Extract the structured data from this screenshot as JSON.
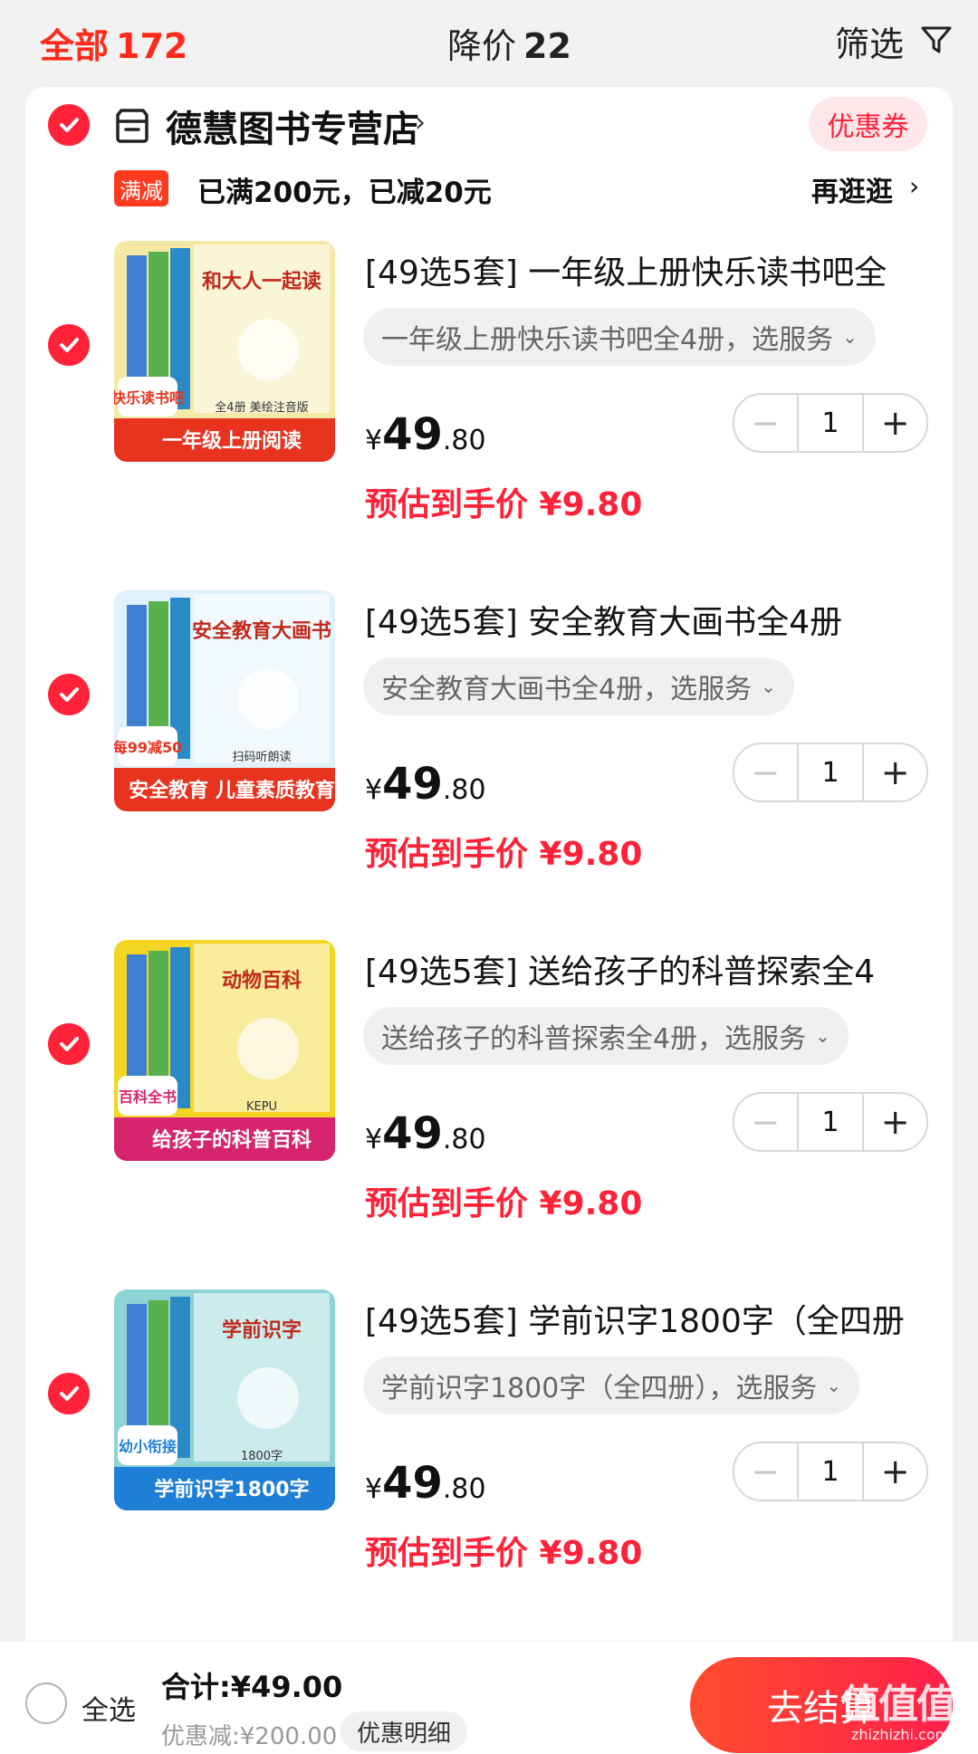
{
  "tabs": {
    "all_label": "全部",
    "all_count": "172",
    "drop_label": "降价",
    "drop_count": "22",
    "filter_label": "筛选"
  },
  "store": {
    "name": "德慧图书专营店",
    "arrow": "›",
    "coupon": "优惠券",
    "promo_tag": "满减",
    "promo_text": "已满200元，已减20元",
    "browse": "再逛逛",
    "browse_arrow": "›"
  },
  "items": [
    {
      "title": "[49选5套] 一年级上册快乐读书吧全",
      "sku": "一年级上册快乐读书吧全4册，选服务",
      "price_yen": "¥",
      "price_int": "49",
      "price_dec": ".80",
      "estimate": "预估到手价 ¥9.80",
      "qty": "1",
      "cover": {
        "banner": "一年级上册阅读",
        "badge": "快乐读书吧",
        "small": "全4册 美绘注音版",
        "headline": "和大人一起读",
        "bg": "#f4e9a6",
        "accent": "#e8331f"
      }
    },
    {
      "title": "[49选5套] 安全教育大画书全4册",
      "sku": "安全教育大画书全4册，选服务",
      "price_yen": "¥",
      "price_int": "49",
      "price_dec": ".80",
      "estimate": "预估到手价 ¥9.80",
      "qty": "1",
      "cover": {
        "banner": "安全教育 儿童素质教育",
        "badge": "每99减50",
        "small": "扫码听朗读",
        "headline": "安全教育大画书",
        "bg": "#dff1fb",
        "accent": "#e8331f"
      }
    },
    {
      "title": "[49选5套] 送给孩子的科普探索全4",
      "sku": "送给孩子的科普探索全4册，选服务",
      "price_yen": "¥",
      "price_int": "49",
      "price_dec": ".80",
      "estimate": "预估到手价 ¥9.80",
      "qty": "1",
      "cover": {
        "banner": "给孩子的科普百科",
        "badge": "百科全书",
        "small": "KEPU",
        "headline": "动物百科",
        "bg": "#f2d623",
        "accent": "#d6246e"
      }
    },
    {
      "title": "[49选5套] 学前识字1800字（全四册",
      "sku": "学前识字1800字（全四册），选服务",
      "price_yen": "¥",
      "price_int": "49",
      "price_dec": ".80",
      "estimate": "预估到手价 ¥9.80",
      "qty": "1",
      "cover": {
        "banner": "学前识字1800字",
        "badge": "幼小衔接",
        "small": "1800字",
        "headline": "学前识字",
        "bg": "#8fd3d8",
        "accent": "#1f7fd6"
      }
    }
  ],
  "bottom": {
    "select_all": "全选",
    "total": "合计:¥49.00",
    "discount": "优惠减:¥200.00",
    "detail": "优惠明细",
    "checkout": "去结算",
    "watermark": "值值值",
    "watermark_sub": "zhizhizhi.com"
  },
  "colors": {
    "accent_red": "#ff2238",
    "tab_red": "#ff2a1a"
  }
}
